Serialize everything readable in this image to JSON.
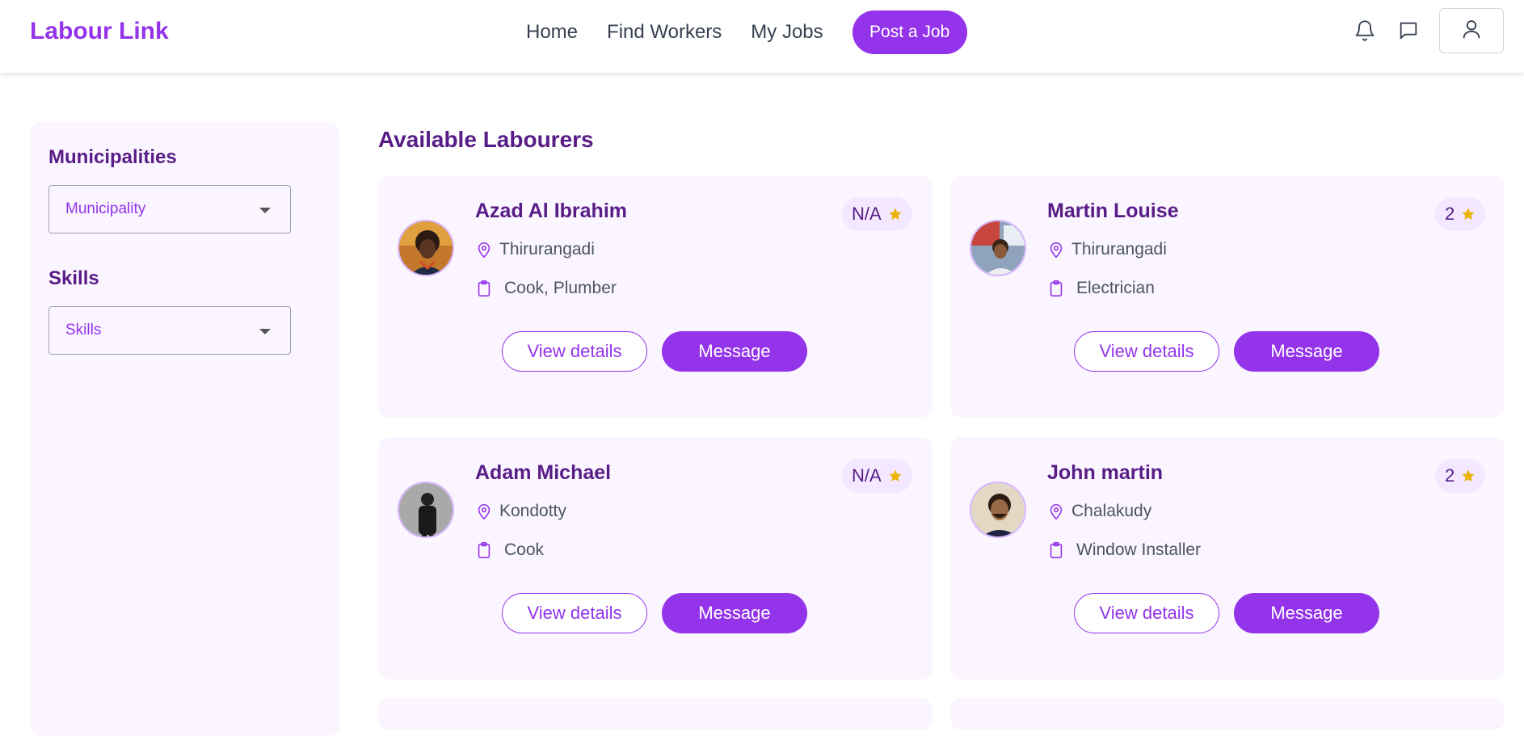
{
  "header": {
    "brand": "Labour Link",
    "nav": [
      "Home",
      "Find Workers",
      "My Jobs"
    ],
    "post_job": "Post a Job",
    "icons": [
      "bell-icon",
      "chat-icon",
      "user-icon"
    ]
  },
  "sidebar": {
    "municipalities_title": "Municipalities",
    "municipality_select": "Municipality",
    "skills_title": "Skills",
    "skills_select": "Skills"
  },
  "main": {
    "title": "Available Labourers",
    "workers": [
      {
        "name": "Azad Al Ibrahim",
        "location": "Thirurangadi",
        "skills": "Cook, Plumber",
        "rating": "N/A"
      },
      {
        "name": "Martin Louise",
        "location": "Thirurangadi",
        "skills": "Electrician",
        "rating": "2"
      },
      {
        "name": "Adam Michael",
        "location": "Kondotty",
        "skills": "Cook",
        "rating": "N/A"
      },
      {
        "name": "John martin",
        "location": "Chalakudy",
        "skills": "Window Installer",
        "rating": "2"
      }
    ],
    "view_details_label": "View details",
    "message_label": "Message"
  },
  "colors": {
    "accent": "#9333ea",
    "heading": "#581c87",
    "card_bg": "#faf5ff",
    "star": "#eab308"
  }
}
